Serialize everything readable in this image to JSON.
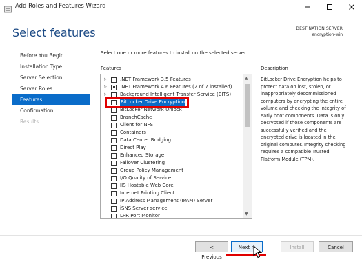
{
  "window": {
    "title": "Add Roles and Features Wizard",
    "buttons": [
      "minimize-icon",
      "maximize-icon",
      "close-icon"
    ]
  },
  "header": {
    "page_title": "Select features",
    "destination_label": "DESTINATION SERVER",
    "destination_server": "encryption-win"
  },
  "nav": {
    "items": [
      {
        "label": "Before You Begin",
        "state": "normal"
      },
      {
        "label": "Installation Type",
        "state": "normal"
      },
      {
        "label": "Server Selection",
        "state": "normal"
      },
      {
        "label": "Server Roles",
        "state": "normal"
      },
      {
        "label": "Features",
        "state": "active"
      },
      {
        "label": "Confirmation",
        "state": "normal"
      },
      {
        "label": "Results",
        "state": "disabled"
      }
    ]
  },
  "main": {
    "instruction": "Select one or more features to install on the selected server.",
    "features_label": "Features",
    "features": [
      {
        "label": ".NET Framework 3.5 Features",
        "expandable": true,
        "checked": "none"
      },
      {
        "label": ".NET Framework 4.6 Features (2 of 7 installed)",
        "expandable": true,
        "checked": "partial"
      },
      {
        "label": "Background Intelligent Transfer Service (BITS)",
        "expandable": true,
        "checked": "none"
      },
      {
        "label": "BitLocker Drive Encryption",
        "expandable": false,
        "checked": "none",
        "selected": true
      },
      {
        "label": "BitLocker Network Unlock",
        "expandable": false,
        "checked": "none"
      },
      {
        "label": "BranchCache",
        "expandable": false,
        "checked": "none"
      },
      {
        "label": "Client for NFS",
        "expandable": false,
        "checked": "none"
      },
      {
        "label": "Containers",
        "expandable": false,
        "checked": "none"
      },
      {
        "label": "Data Center Bridging",
        "expandable": false,
        "checked": "none"
      },
      {
        "label": "Direct Play",
        "expandable": false,
        "checked": "none"
      },
      {
        "label": "Enhanced Storage",
        "expandable": false,
        "checked": "none"
      },
      {
        "label": "Failover Clustering",
        "expandable": false,
        "checked": "none"
      },
      {
        "label": "Group Policy Management",
        "expandable": false,
        "checked": "none"
      },
      {
        "label": "I/O Quality of Service",
        "expandable": false,
        "checked": "none"
      },
      {
        "label": "IIS Hostable Web Core",
        "expandable": false,
        "checked": "none"
      },
      {
        "label": "Internet Printing Client",
        "expandable": false,
        "checked": "none"
      },
      {
        "label": "IP Address Management (IPAM) Server",
        "expandable": false,
        "checked": "none"
      },
      {
        "label": "iSNS Server service",
        "expandable": false,
        "checked": "none"
      },
      {
        "label": "LPR Port Monitor",
        "expandable": false,
        "checked": "none"
      }
    ],
    "description_label": "Description",
    "description": "BitLocker Drive Encryption helps to protect data on lost, stolen, or inappropriately decommissioned computers by encrypting the entire volume and checking the integrity of early boot components. Data is only decrypted if those components are successfully verified and the encrypted drive is located in the original computer. Integrity checking requires a compatible Trusted Platform Module (TPM)."
  },
  "footer": {
    "previous_label": "< Previous",
    "next_label": "Next >",
    "install_label": "Install",
    "cancel_label": "Cancel"
  },
  "colors": {
    "accent": "#0a6cc9",
    "title_blue": "#1c4a85",
    "highlight_red": "#e00000"
  }
}
